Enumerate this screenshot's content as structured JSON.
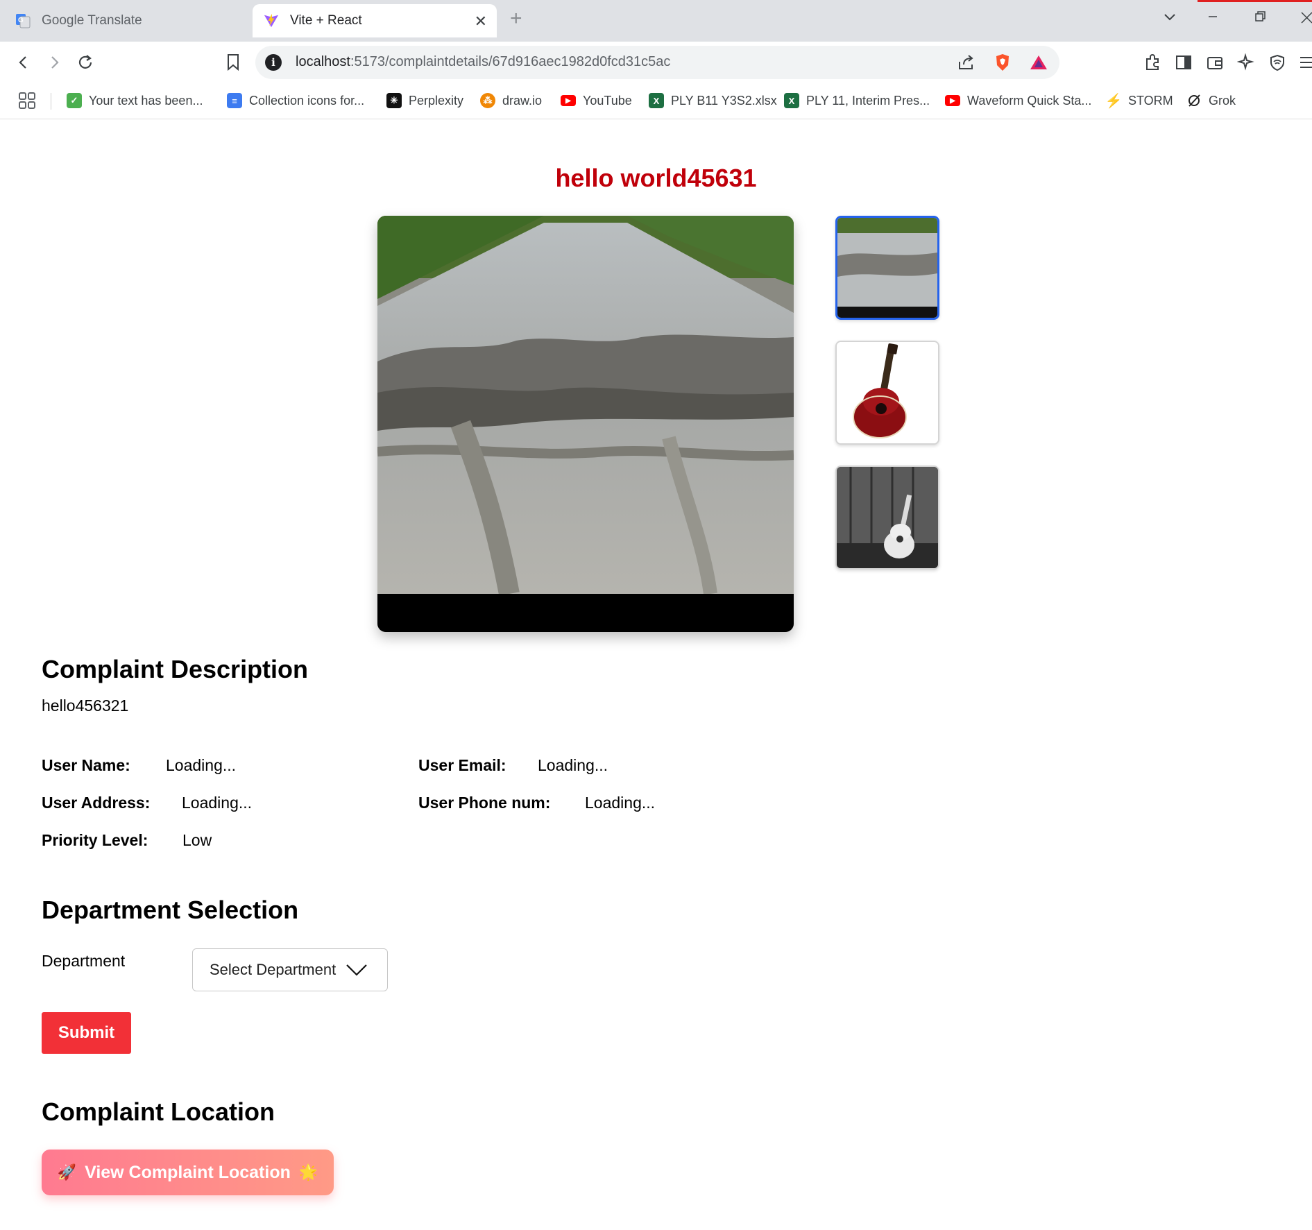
{
  "browser": {
    "tabs": [
      {
        "label": "Google Translate",
        "icon": "google-translate-icon"
      },
      {
        "label": "Vite + React",
        "icon": "vite-icon",
        "active": true
      }
    ],
    "new_tab": "+",
    "url_host": "localhost",
    "url_path": ":5173/complaintdetails/67d916aec1982d0fcd31c5ac",
    "bookmarks": [
      {
        "label": "Your text has been...",
        "icon": "checkmark-icon",
        "color": "#4caf50"
      },
      {
        "label": "Collection icons for...",
        "icon": "document-icon",
        "color": "#3d7bf0"
      },
      {
        "label": "Perplexity",
        "icon": "perplexity-icon",
        "color": "#111111"
      },
      {
        "label": "draw.io",
        "icon": "drawio-icon",
        "color": "#f08705"
      },
      {
        "label": "YouTube",
        "icon": "youtube-icon",
        "color": "#ff0000"
      },
      {
        "label": "PLY B11 Y3S2.xlsx",
        "icon": "excel-icon",
        "color": "#1d6f42"
      },
      {
        "label": "PLY 11, Interim Pres...",
        "icon": "excel-icon",
        "color": "#1d6f42"
      },
      {
        "label": "Waveform Quick Sta...",
        "icon": "youtube-icon",
        "color": "#ff0000"
      },
      {
        "label": "STORM",
        "icon": "lightning-icon",
        "color": "#3b6de0"
      },
      {
        "label": "Grok",
        "icon": "grok-icon",
        "color": "#222222"
      }
    ]
  },
  "page": {
    "title": "hello world45631",
    "complaint_description_heading": "Complaint Description",
    "description": "hello456321",
    "fields": {
      "user_name_label": "User Name:",
      "user_name_value": "Loading...",
      "user_email_label": "User Email:",
      "user_email_value": "Loading...",
      "user_address_label": "User Address:",
      "user_address_value": "Loading...",
      "user_phone_label": "User Phone num:",
      "user_phone_value": "Loading...",
      "priority_label": "Priority Level:",
      "priority_value": "Low"
    },
    "department_heading": "Department Selection",
    "department_label": "Department",
    "department_select_placeholder": "Select Department",
    "submit_label": "Submit",
    "location_heading": "Complaint Location",
    "location_button_label": "View Complaint Location",
    "location_button_emoji_left": "🚀",
    "location_button_emoji_right": "🌟",
    "images": {
      "main": "road-pothole-image",
      "thumbnails": [
        "road-thumbnail",
        "red-guitar-thumbnail",
        "bw-guitar-thumbnail"
      ],
      "selected_thumbnail": 0
    },
    "colors": {
      "title": "#c0000a",
      "submit": "#f23037",
      "thumbnail_selected_border": "#2563eb"
    }
  }
}
